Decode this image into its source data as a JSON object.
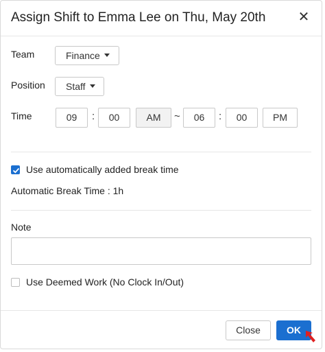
{
  "dialog": {
    "title": "Assign Shift to Emma Lee on Thu, May 20th",
    "close_icon": "close-icon"
  },
  "team": {
    "label": "Team",
    "value": "Finance"
  },
  "position": {
    "label": "Position",
    "value": "Staff"
  },
  "time": {
    "label": "Time",
    "start_hour": "09",
    "start_minute": "00",
    "start_period": "AM",
    "range_separator": "~",
    "end_hour": "06",
    "end_minute": "00",
    "end_period": "PM",
    "colon": ":"
  },
  "break": {
    "auto_label": "Use automatically added break time",
    "auto_checked": true,
    "auto_break_text": "Automatic Break Time : 1h"
  },
  "note": {
    "label": "Note",
    "value": ""
  },
  "deemed": {
    "label": "Use Deemed Work (No Clock In/Out)",
    "checked": false
  },
  "footer": {
    "close_label": "Close",
    "ok_label": "OK"
  },
  "colors": {
    "accent": "#1b6fd0",
    "pointer": "#e02020"
  }
}
